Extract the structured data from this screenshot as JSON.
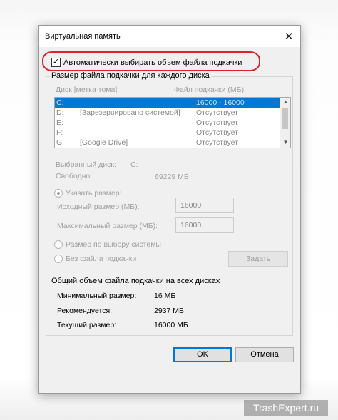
{
  "window": {
    "title": "Виртуальная память",
    "close_glyph": "✕"
  },
  "auto_checkbox": {
    "label": "Автоматически выбирать объем файла подкачки",
    "checked": true,
    "check_glyph": "✓"
  },
  "per_disk_group": {
    "title": "Размер файла подкачки для каждого диска",
    "columns": [
      "Диск [метка тома]",
      "Файл подкачки (МБ)"
    ],
    "rows": [
      {
        "drive": "C:",
        "label": "",
        "size": "16000 - 16000",
        "selected": true
      },
      {
        "drive": "D:",
        "label": "[Зарезервировано системой]",
        "size": "Отсутствует",
        "selected": false
      },
      {
        "drive": "E:",
        "label": "",
        "size": "Отсутствует",
        "selected": false
      },
      {
        "drive": "F:",
        "label": "",
        "size": "Отсутствует",
        "selected": false
      },
      {
        "drive": "G:",
        "label": "[Google Drive]",
        "size": "Отсутствует",
        "selected": false
      }
    ],
    "selected_disk_label": "Выбранный диск:",
    "selected_disk_value": "C:",
    "free_label": "Свободно:",
    "free_value": "69229 МБ",
    "custom_size_label": "Указать размер:",
    "initial_size_label": "Исходный размер (МБ):",
    "initial_size_value": "16000",
    "max_size_label": "Максимальный размер (МБ):",
    "max_size_value": "16000",
    "system_managed_label": "Размер по выбору системы",
    "no_paging_label": "Без файла подкачки",
    "set_button": "Задать"
  },
  "total_group": {
    "title": "Общий объем файла подкачки на всех дисках",
    "min_label": "Минимальный размер:",
    "min_value": "16 МБ",
    "recommended_label": "Рекомендуется:",
    "recommended_value": "2937 МБ",
    "current_label": "Текущий размер:",
    "current_value": "16000 МБ"
  },
  "buttons": {
    "ok": "OK",
    "cancel": "Отмена"
  },
  "watermark": "TrashExpert.ru",
  "colors": {
    "selection": "#0078d7",
    "highlight_ring": "#e0202a",
    "dialog_bg": "#f0f0f0"
  }
}
